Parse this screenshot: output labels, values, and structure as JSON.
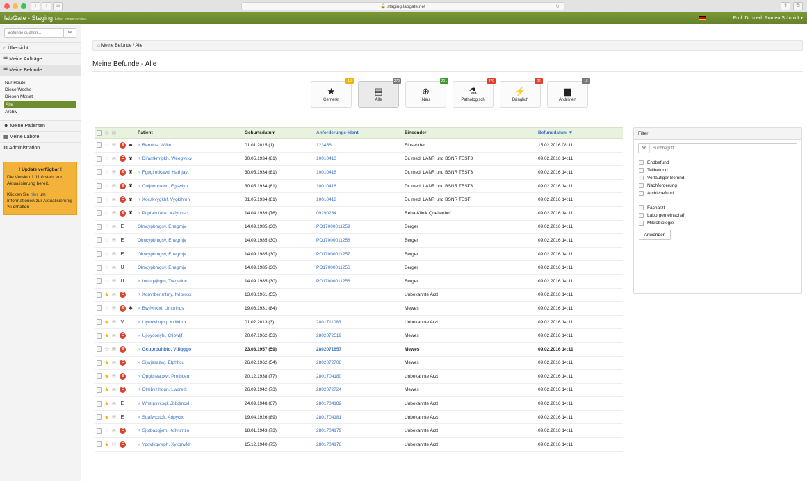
{
  "browser": {
    "url": "staging.labgate.net"
  },
  "app": {
    "brand": "labGate - Staging",
    "tagline": "Labor einfach online.",
    "user": "Prof. Dr. med. Rumen Schmidt"
  },
  "sidebar": {
    "search_placeholder": "Befunde suchen...",
    "items": [
      {
        "label": "Übersicht"
      },
      {
        "label": "Meine Aufträge"
      },
      {
        "label": "Meine Befunde"
      }
    ],
    "subitems": [
      "Nur Heute",
      "Diese Woche",
      "Diesen Monat",
      "Alle",
      "Archiv"
    ],
    "items2": [
      {
        "label": "Meine Patienten"
      },
      {
        "label": "Meine Labore"
      },
      {
        "label": "Administration"
      }
    ],
    "update": {
      "title": "! Update verfügbar !",
      "text1": "Die Version 1.11.0 steht zur Aktualisierung bereit.",
      "text2a": "Klicken Sie ",
      "link": "hier",
      "text2b": " um Informationen zur Aktualisierung zu erhalten."
    }
  },
  "breadcrumb": {
    "a": "Meine Befunde",
    "b": "Alle"
  },
  "page_title": "Meine Befunde - Alle",
  "categories": [
    {
      "label": "Gemerkt",
      "badge": "10",
      "icon": "★",
      "color": "#f0b400"
    },
    {
      "label": "Alle",
      "badge": "279",
      "icon": "▤",
      "color": "#777777"
    },
    {
      "label": "Neu",
      "badge": "201",
      "icon": "⊕",
      "color": "#3a9a2a"
    },
    {
      "label": "Pathologisch",
      "badge": "279",
      "icon": "⚗",
      "color": "#d9432d"
    },
    {
      "label": "Dringlich",
      "badge": "26",
      "icon": "⚡",
      "color": "#d9432d"
    },
    {
      "label": "Archiviert",
      "badge": "16",
      "icon": "▆",
      "color": "#777777"
    }
  ],
  "table": {
    "headers": {
      "patient": "Patient",
      "geburtsdatum": "Geburtsdatum",
      "ident": "Anforderungs-Ident",
      "einsender": "Einsender",
      "befunddatum": "Befunddatum ▼"
    },
    "rows": [
      {
        "star": false,
        "mark": "E",
        "extra": "♣",
        "patient": "♂ Berntus, Willie",
        "geb": "01.01.2015 (1)",
        "ident": "123456",
        "ein": "Einsender",
        "bef": "15.02.2016 08:11",
        "bold": false
      },
      {
        "star": false,
        "mark": "E",
        "extra": "♜",
        "patient": "♀ Difamkmfpkh, Weegvkky",
        "geb": "30.05.1934 (81)",
        "ident": "10010418",
        "ein": "Dr. med. LANR und BSNR TEST3",
        "bef": "09.02.2016 14:11",
        "bold": false
      },
      {
        "star": false,
        "mark": "E",
        "extra": "♜",
        "patient": "♀ Fgpgimdcavd, Harhjayt",
        "geb": "30.05.1934 (81)",
        "ident": "10010418",
        "ein": "Dr. med. LANR und BSNR TEST3",
        "bef": "09.02.2016 14:11",
        "bold": false
      },
      {
        "star": false,
        "mark": "E",
        "extra": "♜",
        "patient": "♀ Cutjnnbpxwo, Egswiytx",
        "geb": "30.05.1934 (81)",
        "ident": "10010418",
        "ein": "Dr. med. LANR und BSNR TEST3",
        "bef": "09.02.2016 14:11",
        "bold": false
      },
      {
        "star": false,
        "mark": "E",
        "extra": "♜",
        "patient": "♀ Xocskvygkhf, Vygkihmn",
        "geb": "31.05.1934 (81)",
        "ident": "10010418",
        "ein": "Dr. med. LANR und BSNR TEST",
        "bef": "09.02.2016 14:11",
        "bold": false
      },
      {
        "star": false,
        "mark": "E",
        "extra": "♜",
        "patient": "♀ Pcptatvxahk, Xzfyhnsc",
        "geb": "14.04.1939 (76)",
        "ident": "09290234",
        "ein": "Reha-Klinik Quellenhof",
        "bef": "09.02.2016 14:11",
        "bold": false
      },
      {
        "star": false,
        "mark": "",
        "extra": "E",
        "patient": "Olmcypbmgsv, Enegmjv",
        "geb": "14.09.1985 (30)",
        "ident": "PO17000011259",
        "ein": "Berger",
        "bef": "09.02.2016 14:11",
        "bold": false
      },
      {
        "star": false,
        "mark": "",
        "extra": "E",
        "patient": "Olmcypbmgsv, Enegmjv",
        "geb": "14.09.1985 (30)",
        "ident": "PO17000011258",
        "ein": "Berger",
        "bef": "09.02.2016 14:11",
        "bold": false
      },
      {
        "star": false,
        "mark": "",
        "extra": "E",
        "patient": "Olmcypbmgsv, Enegmjv",
        "geb": "14.09.1985 (30)",
        "ident": "PO17000011257",
        "ein": "Berger",
        "bef": "09.02.2016 14:11",
        "bold": false
      },
      {
        "star": false,
        "mark": "",
        "extra": "U",
        "patient": "Olmcypbmgsv, Enegmjv",
        "geb": "14.09.1985 (30)",
        "ident": "PO17000011256",
        "ein": "Berger",
        "bef": "09.02.2016 14:11",
        "bold": false
      },
      {
        "star": false,
        "mark": "",
        "extra": "U",
        "patient": "♂ Inrtuqvjhgm, Twzjvdoc",
        "geb": "14.09.1985 (30)",
        "ident": "PO17000011256",
        "ein": "Berger",
        "bef": "09.02.2016 14:11",
        "bold": false
      },
      {
        "star": true,
        "mark": "E",
        "extra": "",
        "patient": "♀ Xqmnbenmtmy, Iwlprosx",
        "geb": "13.03.1961 (55)",
        "ident": "",
        "ein": "Unbekannte Arzt",
        "bef": "09.02.2016 14:11",
        "bold": false
      },
      {
        "star": false,
        "mark": "E",
        "extra": "✱",
        "patient": "♂ Bwjfvnxlxl, Umbrinqs",
        "geb": "19.08.1931 (84)",
        "ident": "",
        "ein": "Mewes",
        "bef": "09.02.2016 14:11",
        "bold": false
      },
      {
        "star": true,
        "mark": "",
        "extra": "V",
        "patient": "♂ Liynnwixqnq, Kxllxhnx",
        "geb": "01.02.2013 (3)",
        "ident": "2801711083",
        "ein": "Unbekannte Arzt",
        "bef": "09.02.2016 14:11",
        "bold": false
      },
      {
        "star": true,
        "mark": "E",
        "extra": "",
        "patient": "♂ Ujjoyconyhl, Ctlbwljf",
        "geb": "20.07.1962 (53)",
        "ident": "2802072519",
        "ein": "Mewes",
        "bef": "09.02.2016 14:11",
        "bold": false
      },
      {
        "star": false,
        "mark": "E",
        "extra": "",
        "patient": "♀ Gcuprouhbio, Vtiiqggo",
        "geb": "23.03.1957 (59)",
        "ident": "2802071657",
        "ein": "Mewes",
        "bef": "09.02.2016 14:11",
        "bold": true
      },
      {
        "star": true,
        "mark": "E",
        "extra": "",
        "patient": "♂ Sijwjesazwj, Efphlfcu",
        "geb": "26.02.1962 (54)",
        "ident": "2802072708",
        "ein": "Mewes",
        "bef": "09.02.2016 14:11",
        "bold": false
      },
      {
        "star": true,
        "mark": "E",
        "extra": "",
        "patient": "♀ Qpgkheapxvl, Protbcen",
        "geb": "20.12.1938 (77)",
        "ident": "2801704180",
        "ein": "Unbekannte Arzt",
        "bef": "09.02.2016 14:11",
        "bold": false
      },
      {
        "star": true,
        "mark": "E",
        "extra": "",
        "patient": "♀ Olmbvzlhdun, Lwcretlt",
        "geb": "26.09.1942 (73)",
        "ident": "2802072724",
        "ein": "Mewes",
        "bef": "09.02.2016 14:11",
        "bold": false
      },
      {
        "star": true,
        "mark": "",
        "extra": "E",
        "patient": "♂ Whstpsvcsgl, Jbbdmcxl",
        "geb": "24.09.1948 (67)",
        "ident": "2801704182",
        "ein": "Unbekannte Arzt",
        "bef": "09.02.2016 14:11",
        "bold": false
      },
      {
        "star": true,
        "mark": "",
        "extra": "E",
        "patient": "♂ Sqafwxxtcfr, Arlpyclx",
        "geb": "19.04.1926 (89)",
        "ident": "2801704181",
        "ein": "Unbekannte Arzt",
        "bef": "09.02.2016 14:11",
        "bold": false
      },
      {
        "star": false,
        "mark": "E",
        "extra": "",
        "patient": "♀ Sjotbaxqjxm, Kdlvumzo",
        "geb": "18.01.1943 (73)",
        "ident": "2801704179",
        "ein": "Unbekannte Arzt",
        "bef": "09.02.2016 14:11",
        "bold": false
      },
      {
        "star": true,
        "mark": "E",
        "extra": "",
        "patient": "♂ Ypdvlkqvwph, Xykqnvfd",
        "geb": "15.12.1940 (75)",
        "ident": "2801704178",
        "ein": "Unbekannte Arzt",
        "bef": "09.02.2016 14:11",
        "bold": false
      }
    ]
  },
  "filter": {
    "title": "Filter",
    "placeholder": "Suchbegriff",
    "group1": [
      "Endbefund",
      "Teilbefund",
      "Vorläufiger Befund",
      "Nachforderung",
      "Archivbefund"
    ],
    "group2": [
      "Facharzt",
      "Laborgemeinschaft",
      "Mikrobiologie"
    ],
    "apply": "Anwenden"
  }
}
